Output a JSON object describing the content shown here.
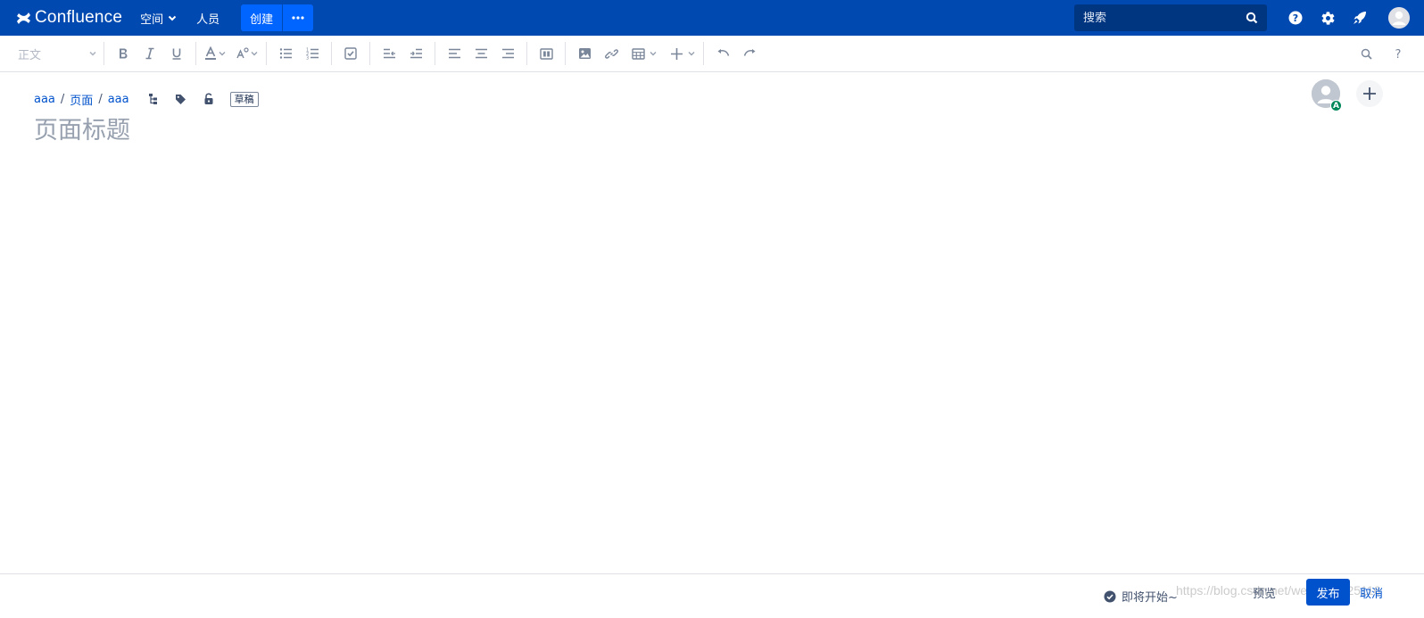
{
  "header": {
    "logo_text": "Confluence",
    "nav_spaces": "空间",
    "nav_people": "人员",
    "create_label": "创建",
    "search_placeholder": "搜索",
    "bg_color": "#0049b0"
  },
  "toolbar": {
    "paragraph_style": "正文"
  },
  "breadcrumb": {
    "items": [
      "aaa",
      "页面",
      "aaa"
    ],
    "separator": "/",
    "draft_badge": "草稿"
  },
  "editor": {
    "title_placeholder": "页面标题"
  },
  "collaborator": {
    "badge": "A"
  },
  "footer": {
    "status": "即将开始~",
    "preview_label": "预览",
    "publish_label": "发布",
    "cancel_label": "取消",
    "watermark": "https://blog.csdn.net/weixin_4225116"
  }
}
